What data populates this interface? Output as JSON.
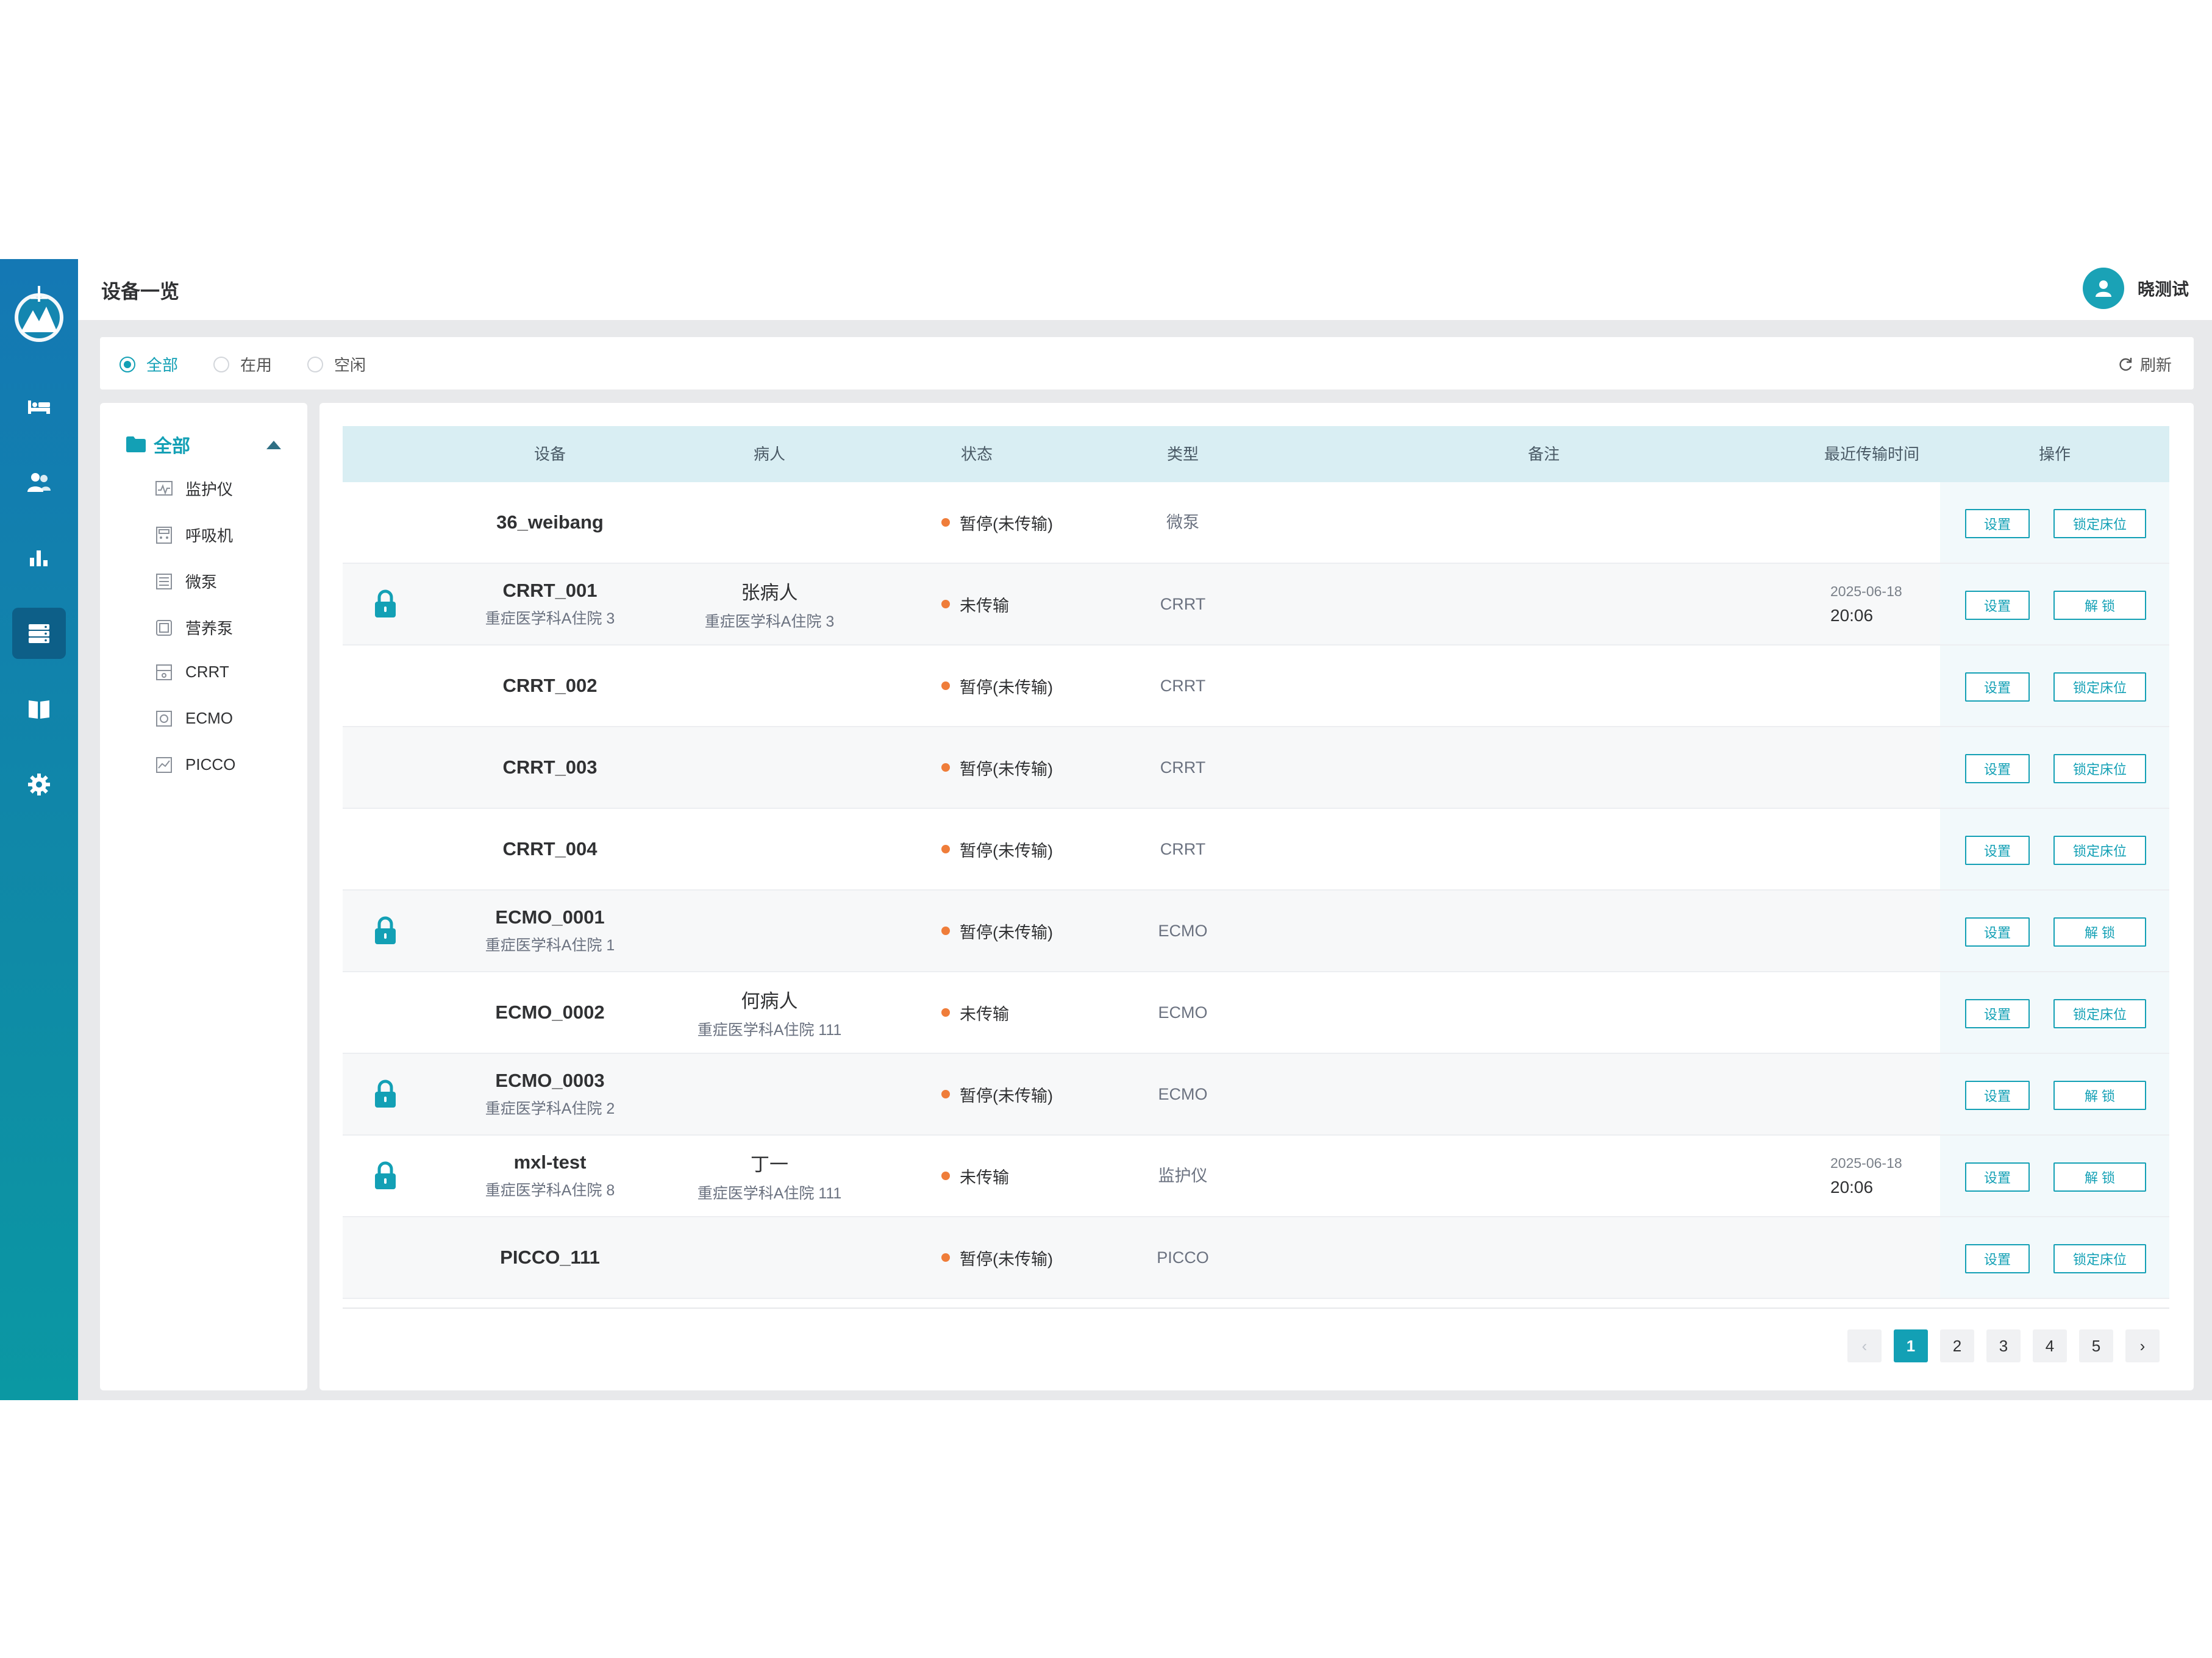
{
  "header": {
    "title": "设备一览",
    "username": "晓测试"
  },
  "nav": {
    "items": [
      {
        "name": "bed-icon"
      },
      {
        "name": "patients-icon"
      },
      {
        "name": "stats-icon"
      },
      {
        "name": "devices-icon",
        "active": true
      },
      {
        "name": "book-icon"
      },
      {
        "name": "settings-icon"
      }
    ]
  },
  "filter": {
    "options": [
      "全部",
      "在用",
      "空闲"
    ],
    "selected": "全部",
    "refresh_label": "刷新"
  },
  "tree": {
    "root_label": "全部",
    "children": [
      "监护仪",
      "呼吸机",
      "微泵",
      "营养泵",
      "CRRT",
      "ECMO",
      "PICCO"
    ]
  },
  "table": {
    "columns": [
      "设备",
      "病人",
      "状态",
      "类型",
      "备注",
      "最近传输时间",
      "操作"
    ],
    "rows": [
      {
        "device": "36_weibang",
        "location": "",
        "patient": "",
        "patient_location": "",
        "status": "暂停(未传输)",
        "type": "微泵",
        "date": "",
        "time": "",
        "locked": false,
        "set_label": "设置",
        "action_label": "锁定床位"
      },
      {
        "device": "CRRT_001",
        "location": "重症医学科A住院 3",
        "patient": "张病人",
        "patient_location": "重症医学科A住院 3",
        "status": "未传输",
        "type": "CRRT",
        "date": "2025-06-18",
        "time": "20:06",
        "locked": true,
        "set_label": "设置",
        "action_label": "解 锁"
      },
      {
        "device": "CRRT_002",
        "location": "",
        "patient": "",
        "patient_location": "",
        "status": "暂停(未传输)",
        "type": "CRRT",
        "date": "",
        "time": "",
        "locked": false,
        "set_label": "设置",
        "action_label": "锁定床位"
      },
      {
        "device": "CRRT_003",
        "location": "",
        "patient": "",
        "patient_location": "",
        "status": "暂停(未传输)",
        "type": "CRRT",
        "date": "",
        "time": "",
        "locked": false,
        "set_label": "设置",
        "action_label": "锁定床位"
      },
      {
        "device": "CRRT_004",
        "location": "",
        "patient": "",
        "patient_location": "",
        "status": "暂停(未传输)",
        "type": "CRRT",
        "date": "",
        "time": "",
        "locked": false,
        "set_label": "设置",
        "action_label": "锁定床位"
      },
      {
        "device": "ECMO_0001",
        "location": "重症医学科A住院 1",
        "patient": "",
        "patient_location": "",
        "status": "暂停(未传输)",
        "type": "ECMO",
        "date": "",
        "time": "",
        "locked": true,
        "set_label": "设置",
        "action_label": "解 锁"
      },
      {
        "device": "ECMO_0002",
        "location": "",
        "patient": "何病人",
        "patient_location": "重症医学科A住院 111",
        "status": "未传输",
        "type": "ECMO",
        "date": "",
        "time": "",
        "locked": false,
        "set_label": "设置",
        "action_label": "锁定床位"
      },
      {
        "device": "ECMO_0003",
        "location": "重症医学科A住院 2",
        "patient": "",
        "patient_location": "",
        "status": "暂停(未传输)",
        "type": "ECMO",
        "date": "",
        "time": "",
        "locked": true,
        "set_label": "设置",
        "action_label": "解 锁"
      },
      {
        "device": "mxl-test",
        "location": "重症医学科A住院 8",
        "patient": "丁一",
        "patient_location": "重症医学科A住院 111",
        "status": "未传输",
        "type": "监护仪",
        "date": "2025-06-18",
        "time": "20:06",
        "locked": true,
        "set_label": "设置",
        "action_label": "解 锁"
      },
      {
        "device": "PICCO_111",
        "location": "",
        "patient": "",
        "patient_location": "",
        "status": "暂停(未传输)",
        "type": "PICCO",
        "date": "",
        "time": "",
        "locked": false,
        "set_label": "设置",
        "action_label": "锁定床位"
      }
    ]
  },
  "pagination": {
    "prev": "‹",
    "next": "›",
    "pages": [
      "1",
      "2",
      "3",
      "4",
      "5"
    ],
    "current": "1"
  },
  "colors": {
    "accent": "#13a0b5",
    "status_dot": "#ef7d3a",
    "nav_top": "#1478b4",
    "nav_bottom": "#0b98a3"
  }
}
